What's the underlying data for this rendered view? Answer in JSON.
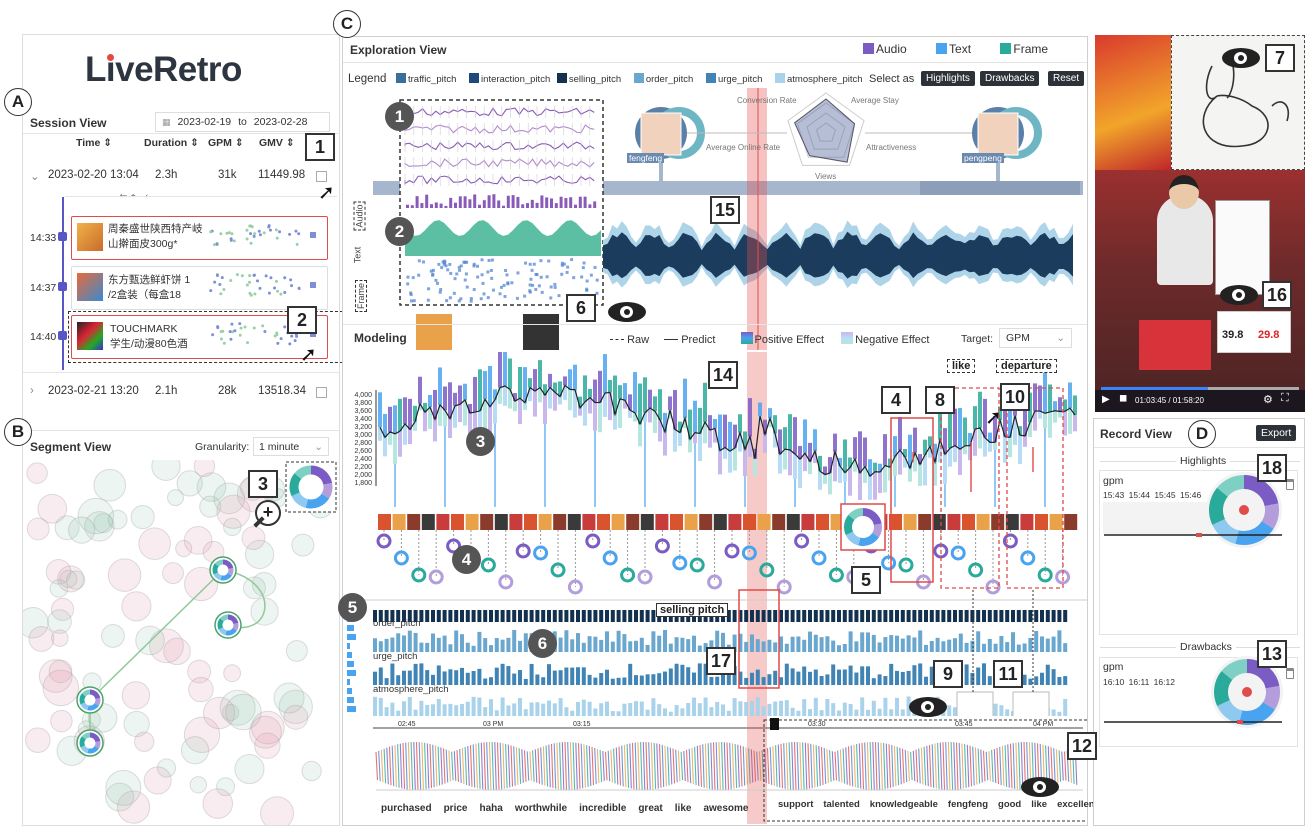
{
  "app": {
    "logo": "LiveRetro"
  },
  "labels": {
    "A": "A",
    "B": "B",
    "C": "C",
    "D": "D"
  },
  "session": {
    "title": "Session View",
    "date_from": "2023-02-19",
    "date_to_word": "to",
    "date_to": "2023-02-28",
    "columns": [
      "Time",
      "Duration",
      "GPM",
      "GMV"
    ],
    "sessions": [
      {
        "time": "2023-02-20 13:04",
        "duration": "2.3h",
        "gpm": "31k",
        "gmv": "11449.98"
      },
      {
        "time": "2023-02-21 13:20",
        "duration": "2.1h",
        "gpm": "28k",
        "gmv": "13518.34"
      }
    ],
    "partial_text": "30包盒（",
    "items": [
      {
        "time": "14:33",
        "title1": "周秦盛世陕西特产岐",
        "title2": "山擀面皮300g*"
      },
      {
        "time": "14:37",
        "title1": "东方甄选鲜虾饼 1",
        "title2": "/2盒装（每盒18"
      },
      {
        "time": "14:40",
        "title1": "TOUCHMARK",
        "title2": "学生/动漫80色酒"
      }
    ]
  },
  "segment": {
    "title": "Segment View",
    "granularity_label": "Granularity:",
    "granularity": "1 minute"
  },
  "exploration": {
    "title": "Exploration View",
    "modalities": [
      {
        "name": "Audio",
        "color": "#7b5cc4"
      },
      {
        "name": "Text",
        "color": "#4aa3ee"
      },
      {
        "name": "Frame",
        "color": "#2aaa9a"
      }
    ],
    "legend_label": "Legend",
    "legend_items": [
      {
        "name": "traffic_pitch",
        "color": "#3a6f9a"
      },
      {
        "name": "interaction_pitch",
        "color": "#1d4a7a"
      },
      {
        "name": "selling_pitch",
        "color": "#14304f"
      },
      {
        "name": "order_pitch",
        "color": "#6aa7cf"
      },
      {
        "name": "urge_pitch",
        "color": "#3f84b4"
      },
      {
        "name": "atmosphere_pitch",
        "color": "#a9d3ea"
      }
    ],
    "select_as": "Select as",
    "btn_highlights": "Highlights",
    "btn_drawbacks": "Drawbacks",
    "btn_reset": "Reset",
    "streamers": [
      "fengfeng",
      "pengpeng"
    ],
    "radar_axes": [
      "Conversion Rate",
      "Average Stay",
      "Attractiveness",
      "Views",
      "Average Online Rate"
    ],
    "vertical_labels": [
      "Audio",
      "Text",
      "Frame"
    ]
  },
  "modeling": {
    "title": "Modeling",
    "raw": "Raw",
    "predict": "Predict",
    "positive": "Positive Effect",
    "negative": "Negative Effect",
    "target_label": "Target:",
    "target": "GPM",
    "y_ticks": [
      "4,000",
      "3,800",
      "3,600",
      "3,400",
      "3,200",
      "3,000",
      "2,800",
      "2,600",
      "2,400",
      "2,200",
      "2,000",
      "1,800"
    ],
    "tag_like": "like",
    "tag_departure": "departure",
    "pitch_rows": [
      "order_pitch",
      "urge_pitch",
      "atmosphere_pitch"
    ],
    "selling_tag": "selling pitch"
  },
  "timeline": {
    "ticks_top": [
      "02:45",
      "03 PM",
      "03:15",
      "03:30",
      "03:45",
      "04 PM"
    ],
    "words_left": [
      "purchased",
      "price",
      "haha",
      "worthwhile",
      "incredible",
      "great",
      "like",
      "awesome"
    ],
    "words_right": [
      "support",
      "talented",
      "knowledgeable",
      "fengfeng",
      "good",
      "like",
      "excellent"
    ]
  },
  "video": {
    "time": "01:03:45 / 01:58:20",
    "price1": "39.8",
    "price2": "29.8"
  },
  "record": {
    "title": "Record View",
    "export": "Export",
    "highlights_title": "Highlights",
    "drawbacks_title": "Drawbacks",
    "highlight": {
      "metric": "gpm",
      "times": [
        "15:43",
        "15:44",
        "15:45",
        "15:46"
      ]
    },
    "drawback": {
      "metric": "gpm",
      "times": [
        "16:10",
        "16:11",
        "16:12"
      ]
    }
  },
  "markers": {
    "sq": [
      "1",
      "2",
      "3",
      "4",
      "5",
      "6",
      "7",
      "8",
      "9",
      "10",
      "11",
      "12",
      "13",
      "14",
      "15",
      "16",
      "17",
      "18"
    ],
    "dc": [
      "1",
      "2",
      "3",
      "4",
      "5",
      "6"
    ]
  }
}
